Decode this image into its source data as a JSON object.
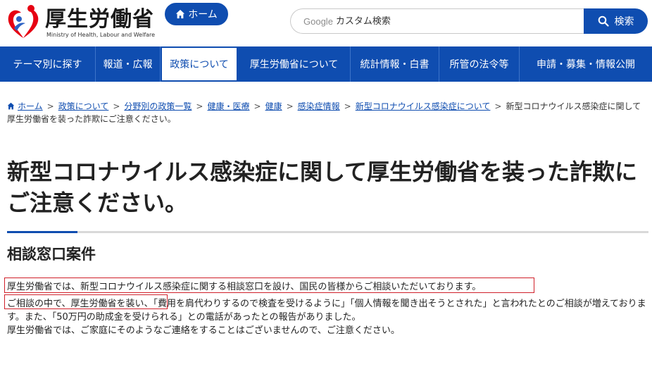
{
  "header": {
    "logo_text": "厚生労働省",
    "logo_subtext": "Ministry of Health, Labour and Welfare",
    "home_label": "ホーム"
  },
  "search": {
    "brand": "Google",
    "placeholder": "カスタム検索",
    "button_label": "検索"
  },
  "nav": {
    "items": [
      {
        "label": "テーマ別に探す"
      },
      {
        "label": "報道・広報"
      },
      {
        "label": "政策について"
      },
      {
        "label": "厚生労働省について"
      },
      {
        "label": "統計情報・白書"
      },
      {
        "label": "所管の法令等"
      },
      {
        "label": "申請・募集・情報公開"
      }
    ]
  },
  "breadcrumb": {
    "items": [
      "ホーム",
      "政策について",
      "分野別の政策一覧",
      "健康・医療",
      "健康",
      "感染症情報",
      "新型コロナウイルス感染症について"
    ],
    "current": "新型コロナウイルス感染症に関して厚生労働省を装った詐欺にご注意ください。"
  },
  "main": {
    "title": "新型コロナウイルス感染症に関して厚生労働省を装った詐欺にご注意ください。",
    "section_heading": "相談窓口案件",
    "paragraph1": "厚生労働省では、新型コロナウイルス感染症に関する相談窓口を設け、国民の皆様からご相談いただいております。",
    "paragraph2": "ご相談の中で、厚生労働省を装い、「費用を肩代わりするので検査を受けるように」「個人情報を聞き出そうとされた」と言われたとのご相談が増えております。また、「50万円の助成金を受けられる」との電話があったとの報告がありました。",
    "paragraph3": "厚生労働省では、ご家庭にそのようなご連絡をすることはございませんので、ご注意ください。"
  },
  "colors": {
    "brand_blue": "#0f4db0",
    "highlight_red": "#d0202a"
  },
  "icons": {
    "logo": "mhlw-logo-icon",
    "home": "home-icon",
    "search": "magnifier-icon"
  }
}
